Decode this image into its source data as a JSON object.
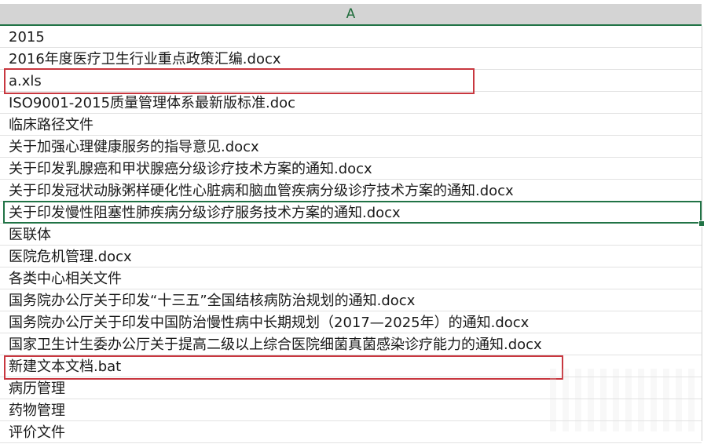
{
  "sheet": {
    "column_header": "A",
    "rows": [
      "2015",
      "2016年度医疗卫生行业重点政策汇编.docx",
      "a.xls",
      "ISO9001-2015质量管理体系最新版标准.doc",
      "临床路径文件",
      "关于加强心理健康服务的指导意见.docx",
      "关于印发乳腺癌和甲状腺癌分级诊疗技术方案的通知.docx",
      "关于印发冠状动脉粥样硬化性心脏病和脑血管疾病分级诊疗技术方案的通知.docx",
      "关于印发慢性阻塞性肺疾病分级诊疗服务技术方案的通知.docx",
      "医联体",
      "医院危机管理.docx",
      "各类中心相关文件",
      "国务院办公厅关于印发“十三五”全国结核病防治规划的通知.docx",
      "国务院办公厅关于印发中国防治慢性病中长期规划（2017—2025年）的通知.docx",
      "国家卫生计生委办公厅关于提高二级以上综合医院细菌真菌感染诊疗能力的通知.docx",
      "新建文本文档.bat",
      "病历管理",
      "药物管理",
      "评价文件"
    ]
  },
  "colors": {
    "header_bg": "#d4d4d4",
    "accent_green": "#217346",
    "highlight_red": "#c8373f"
  }
}
